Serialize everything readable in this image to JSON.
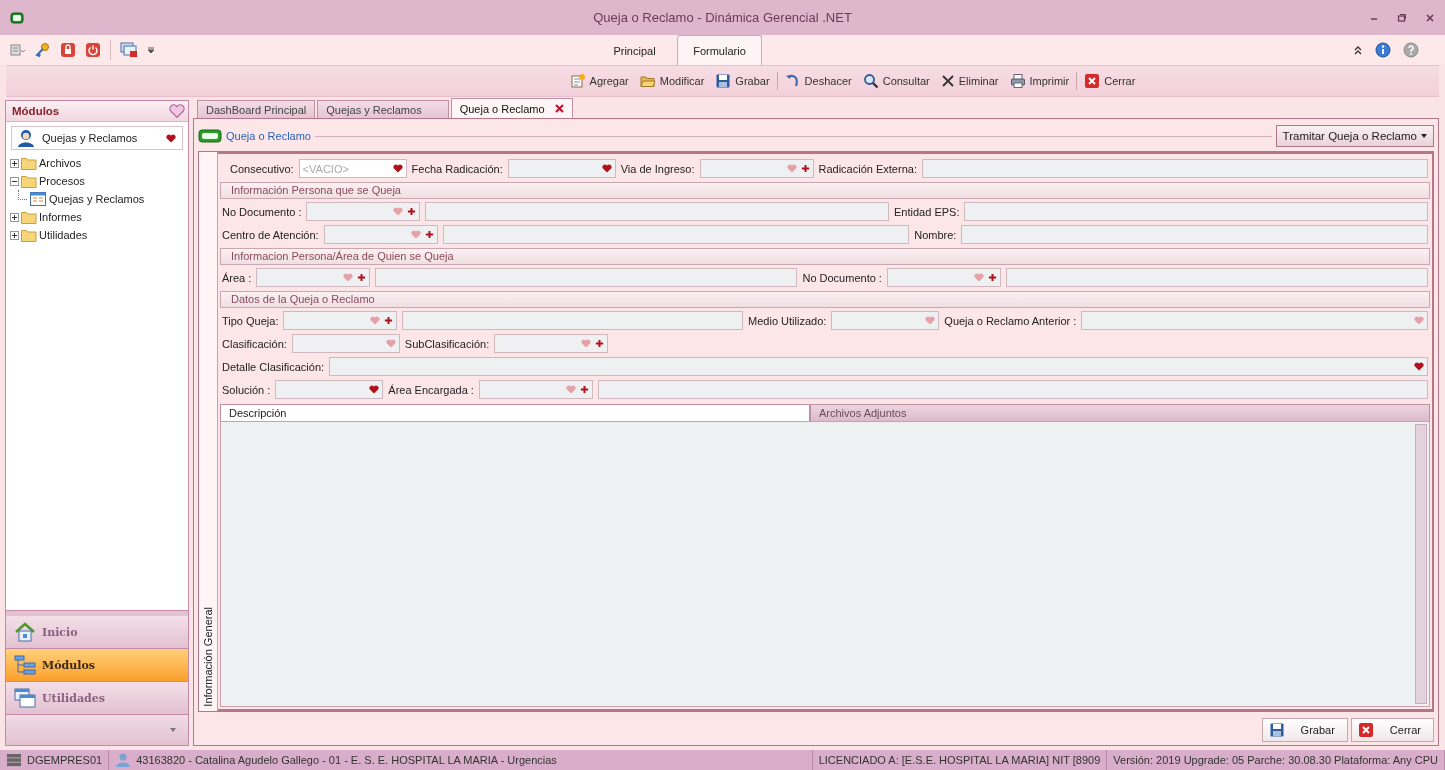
{
  "window": {
    "title": "Queja o Reclamo - Dinámica Gerencial .NET"
  },
  "ribbon_tabs": [
    {
      "label": "Principal",
      "selected": false
    },
    {
      "label": "Formulario",
      "selected": true
    }
  ],
  "toolbar": [
    {
      "label": "Agregar",
      "kind": "add"
    },
    {
      "label": "Modificar",
      "kind": "edit"
    },
    {
      "label": "Grabar",
      "kind": "save"
    },
    {
      "label": "Deshacer",
      "kind": "undo"
    },
    {
      "label": "Consultar",
      "kind": "search"
    },
    {
      "label": "Eliminar",
      "kind": "delete"
    },
    {
      "label": "Imprimir",
      "kind": "print"
    },
    {
      "label": "Cerrar",
      "kind": "close"
    }
  ],
  "sidebar": {
    "title": "Módulos",
    "module": "Quejas y Reclamos",
    "tree": [
      {
        "label": "Archivos",
        "kind": "folder",
        "expanded": false
      },
      {
        "label": "Procesos",
        "kind": "folder",
        "expanded": true,
        "children": [
          {
            "label": "Quejas y Reclamos",
            "kind": "form"
          }
        ]
      },
      {
        "label": "Informes",
        "kind": "folder",
        "expanded": false
      },
      {
        "label": "Utilidades",
        "kind": "folder",
        "expanded": false
      }
    ],
    "nav": [
      {
        "label": "Inicio",
        "kind": "home",
        "selected": false
      },
      {
        "label": "Módulos",
        "kind": "modules",
        "selected": true
      },
      {
        "label": "Utilidades",
        "kind": "utilities",
        "selected": false
      }
    ]
  },
  "doc_tabs": [
    {
      "label": "DashBoard Principal",
      "selected": false,
      "closable": false
    },
    {
      "label": "Quejas y Reclamos",
      "selected": false,
      "closable": false
    },
    {
      "label": "Queja o Reclamo",
      "selected": true,
      "closable": true
    }
  ],
  "form": {
    "title": "Queja o Reclamo",
    "action": "Tramitar Queja o Reclamo",
    "side_tab": "Información General",
    "top_fields": [
      {
        "label": "Consecutivo:",
        "kind": "combo",
        "placeholder": "<VACIO>",
        "required": true,
        "disabled": false
      },
      {
        "label": "Fecha Radicación:",
        "kind": "combo",
        "required": true,
        "disabled": true
      },
      {
        "label": "Via de Ingreso:",
        "kind": "combo_add",
        "required": false,
        "disabled": true
      },
      {
        "label": "Radicación Externa:",
        "kind": "text",
        "disabled": true
      }
    ],
    "sections": [
      {
        "title": "Información Persona que se Queja",
        "rows": [
          [
            {
              "label": "No Documento :",
              "kind": "combo_add",
              "required": false,
              "disabled": true
            },
            {
              "kind": "text",
              "disabled": true
            },
            {
              "label": "Entidad EPS:",
              "kind": "text",
              "disabled": true
            }
          ],
          [
            {
              "label": "Centro de Atención:",
              "kind": "combo_add",
              "required": false,
              "disabled": true
            },
            {
              "kind": "text",
              "disabled": true
            },
            {
              "label": "Nombre:",
              "kind": "text",
              "disabled": true
            }
          ]
        ]
      },
      {
        "title": "Informacion Persona/Área de Quien se Queja",
        "rows": [
          [
            {
              "label": "Área  :",
              "kind": "combo_add",
              "required": false,
              "disabled": true
            },
            {
              "kind": "text",
              "disabled": true
            },
            {
              "label": "No Documento :",
              "kind": "combo_add",
              "required": false,
              "disabled": true
            },
            {
              "kind": "text",
              "disabled": true
            }
          ]
        ]
      },
      {
        "title": "Datos de la Queja o Reclamo",
        "rows": [
          [
            {
              "label": "Tipo Queja:",
              "kind": "combo_add",
              "required": false,
              "disabled": true
            },
            {
              "kind": "text",
              "disabled": true
            },
            {
              "label": "Medio Utilizado:",
              "kind": "combo",
              "required": false,
              "disabled": true
            },
            {
              "label": "Queja o Reclamo Anterior :",
              "kind": "combo",
              "required": false,
              "disabled": true
            }
          ],
          [
            {
              "label": "Clasificación:",
              "kind": "combo",
              "required": false,
              "disabled": true
            },
            {
              "label": "SubClasificación:",
              "kind": "combo_add",
              "required": false,
              "disabled": true
            }
          ],
          [
            {
              "label": "Detalle Clasificación:",
              "kind": "combo",
              "required": true,
              "disabled": true
            }
          ],
          [
            {
              "label": "Solución :",
              "kind": "combo",
              "required": true,
              "disabled": true
            },
            {
              "label": "Área Encargada :",
              "kind": "combo_add",
              "required": false,
              "disabled": true
            },
            {
              "kind": "text",
              "disabled": true
            }
          ]
        ]
      }
    ],
    "detail_tabs": [
      {
        "label": "Descripción",
        "selected": true
      },
      {
        "label": "Archivos Adjuntos",
        "selected": false
      }
    ],
    "buttons": [
      {
        "label": "Grabar",
        "kind": "save"
      },
      {
        "label": "Cerrar",
        "kind": "close"
      }
    ]
  },
  "status_bar": {
    "server": "DGEMPRES01",
    "user": "43163820 - Catalina Agudelo Gallego  - 01 - E. S. E. HOSPITAL LA MARIA - Urgencias",
    "license": "LICENCIADO A: [E.S.E. HOSPITAL LA MARIA] NIT [8909",
    "version": "Versión: 2019 Upgrade: 05 Parche: 30.08.30 Plataforma: Any CPU"
  }
}
